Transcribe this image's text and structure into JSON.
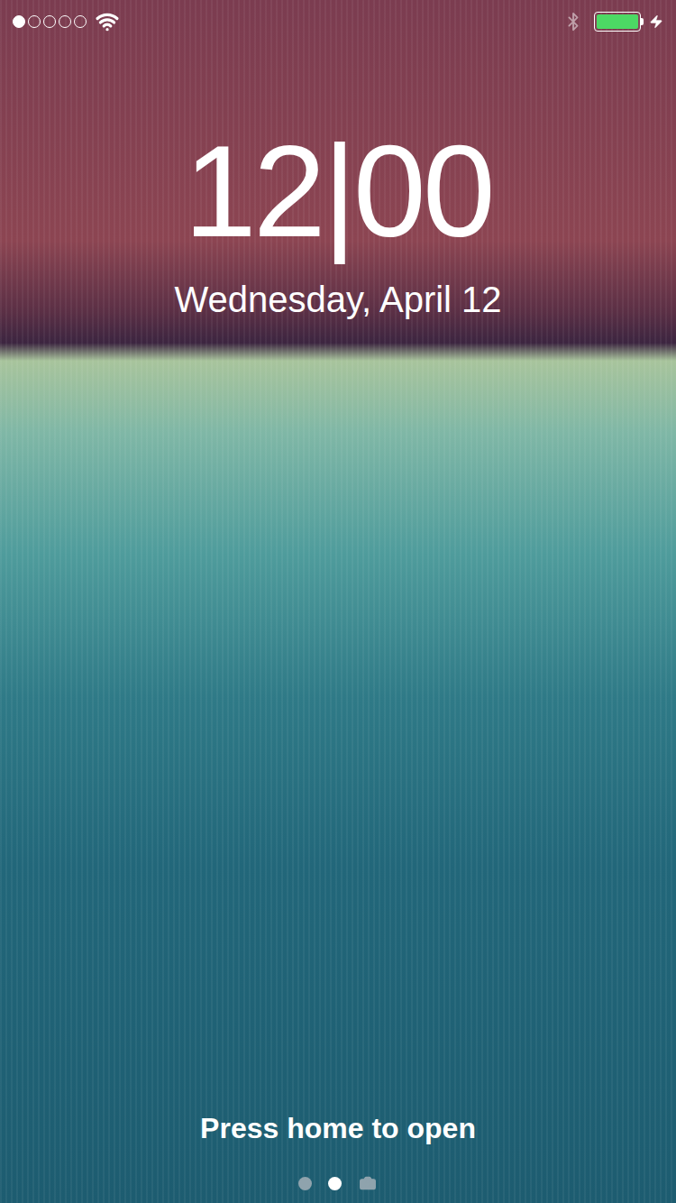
{
  "status_bar": {
    "signal": {
      "level": 0.2
    },
    "wifi": true,
    "bluetooth": true,
    "battery": {
      "level": 1.0,
      "charging": true
    }
  },
  "clock": {
    "time": "12|00",
    "date": "Wednesday, April 12"
  },
  "unlock_hint": "Press home to open",
  "page_indicator": [
    {
      "kind": "dot",
      "selected": false
    },
    {
      "kind": "dot",
      "selected": true
    },
    {
      "kind": "camera",
      "selected": false
    }
  ]
}
